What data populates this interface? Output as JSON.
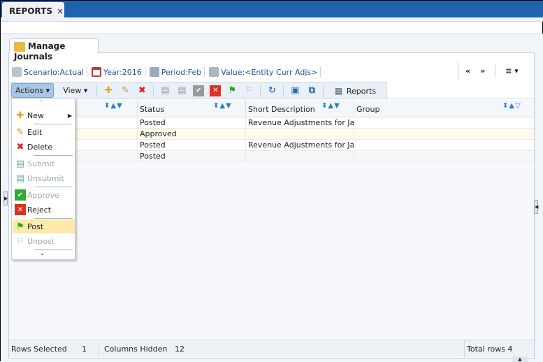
{
  "window": {
    "tab_label": "REPORTS",
    "tab_close": "×"
  },
  "page": {
    "tab_label": "Manage Journals"
  },
  "pov": [
    {
      "label": "Scenario:Actual",
      "icon": "scenario-icon"
    },
    {
      "label": "Year:2016",
      "icon": "calendar-icon"
    },
    {
      "label": "Period:Feb",
      "icon": "period-icon"
    },
    {
      "label": "Value:<Entity Curr Adjs>",
      "icon": "value-icon"
    }
  ],
  "nav": {
    "prev": "«",
    "next": "»",
    "menu": "≡ ▾"
  },
  "toolbar": {
    "actions": "Actions",
    "view": "View",
    "reports": "Reports"
  },
  "table": {
    "columns": [
      "",
      "Status",
      "Short Description",
      "Group"
    ],
    "rows": [
      [
        "",
        "Posted",
        "Revenue Adjustments for Jan -",
        ""
      ],
      [
        "",
        "Approved",
        "",
        ""
      ],
      [
        "",
        "Posted",
        "Revenue Adjustments for Jan -",
        ""
      ],
      [
        "",
        "Posted",
        "",
        ""
      ]
    ]
  },
  "menu": {
    "items": [
      {
        "label": "New",
        "enabled": true
      },
      {
        "label": "Edit",
        "enabled": true
      },
      {
        "label": "Delete",
        "enabled": true
      },
      {
        "label": "Submit",
        "enabled": false
      },
      {
        "label": "Unsubmit",
        "enabled": false
      },
      {
        "label": "Approve",
        "enabled": false
      },
      {
        "label": "Reject",
        "enabled": true
      },
      {
        "label": "Post",
        "enabled": true,
        "highlighted": true
      },
      {
        "label": "Unpost",
        "enabled": false
      }
    ]
  },
  "status": {
    "rows_selected_label": "Rows Selected",
    "rows_selected": "1",
    "columns_hidden_label": "Columns Hidden",
    "columns_hidden": "12",
    "total_rows": "Total rows 4"
  },
  "colors": {
    "brand": "#1f63ae",
    "highlight": "#fde9a8"
  }
}
